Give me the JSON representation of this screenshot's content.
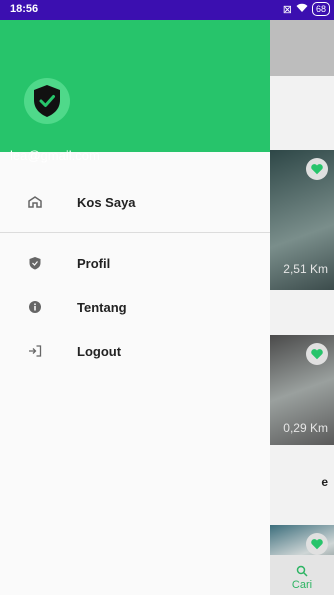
{
  "statusbar": {
    "time": "18:56",
    "battery": "68"
  },
  "drawer": {
    "email": "lea@gmail.com",
    "items": [
      {
        "label": "Kos Saya",
        "icon": "home-icon"
      },
      {
        "label": "Profil",
        "icon": "shield-icon"
      },
      {
        "label": "Tentang",
        "icon": "info-icon"
      },
      {
        "label": "Logout",
        "icon": "logout-icon"
      }
    ]
  },
  "background": {
    "distances": [
      "2,51 Km",
      "0,29 Km"
    ],
    "partial_text": "e",
    "nav_cari": "Cari"
  },
  "colors": {
    "accent": "#27c46b",
    "statusbar": "#3b0fb0"
  }
}
